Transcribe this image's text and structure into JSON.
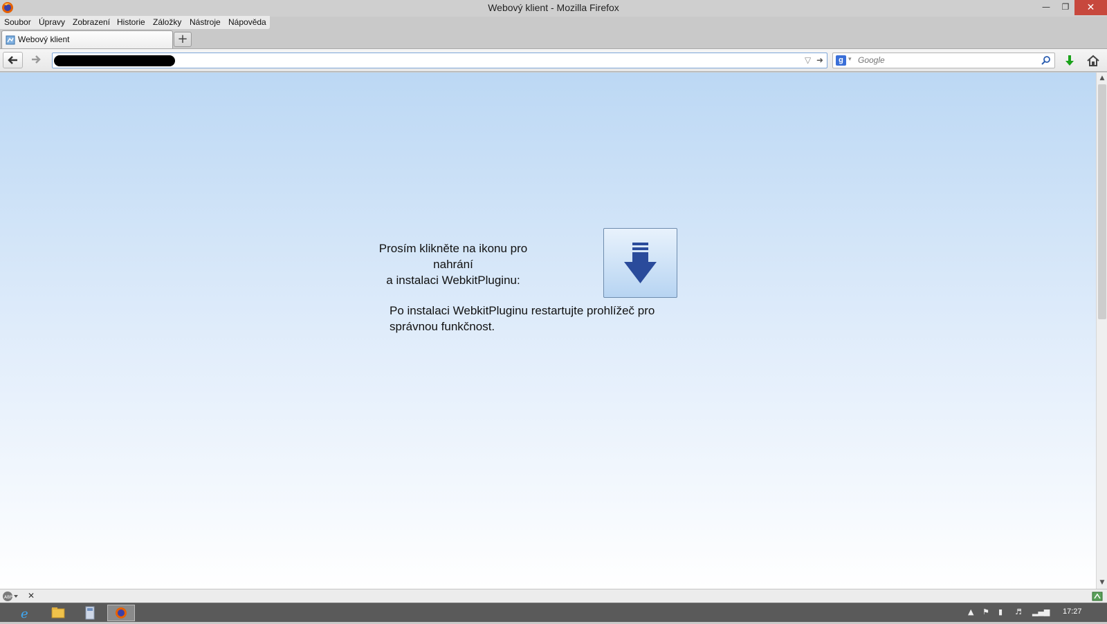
{
  "window": {
    "title": "Webový klient - Mozilla Firefox"
  },
  "menu": [
    {
      "label": "Soubor"
    },
    {
      "label": "Úpravy"
    },
    {
      "label": "Zobrazení"
    },
    {
      "label": "Historie"
    },
    {
      "label": "Záložky"
    },
    {
      "label": "Nástroje"
    },
    {
      "label": "Nápověda"
    }
  ],
  "tabs": [
    {
      "label": "Webový klient"
    }
  ],
  "new_tab_label": "+",
  "search": {
    "placeholder": "Google"
  },
  "content": {
    "prompt_line1": "Prosím klikněte na ikonu pro nahrání",
    "prompt_line2": "a instalaci WebkitPluginu:",
    "note_line1": "Po instalaci WebkitPluginu restartujte prohlížeč pro",
    "note_line2": "správnou funkčnost."
  },
  "taskbar": {
    "clock": "17:27"
  }
}
